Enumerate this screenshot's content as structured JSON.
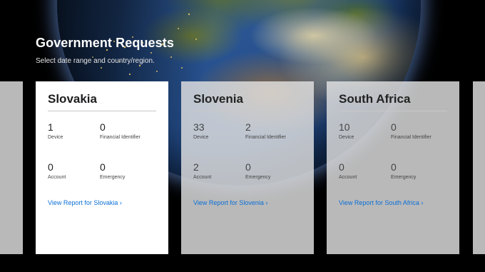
{
  "header": {
    "title": "Government Requests",
    "subtitle": "Select date range and country/region."
  },
  "cards": [
    {
      "country": "Slovakia",
      "stats": [
        {
          "value": "1",
          "label": "Device"
        },
        {
          "value": "0",
          "label": "Financial Identifier"
        },
        {
          "value": "0",
          "label": "Account"
        },
        {
          "value": "0",
          "label": "Emergency"
        }
      ],
      "link": "View Report for Slovakia ›"
    },
    {
      "country": "Slovenia",
      "stats": [
        {
          "value": "33",
          "label": "Device"
        },
        {
          "value": "2",
          "label": "Financial Identifier"
        },
        {
          "value": "2",
          "label": "Account"
        },
        {
          "value": "0",
          "label": "Emergency"
        }
      ],
      "link": "View Report for Slovenia ›"
    },
    {
      "country": "South Africa",
      "stats": [
        {
          "value": "10",
          "label": "Device"
        },
        {
          "value": "0",
          "label": "Financial Identifier"
        },
        {
          "value": "0",
          "label": "Account"
        },
        {
          "value": "0",
          "label": "Emergency"
        }
      ],
      "link": "View Report for South Africa ›"
    }
  ],
  "colors": {
    "link": "#0a6fd6",
    "background": "#000000",
    "active_card": "#ffffff",
    "inactive_card": "#e2e2e2"
  }
}
